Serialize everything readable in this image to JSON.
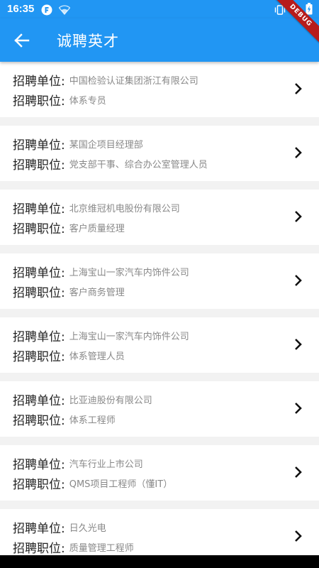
{
  "status_bar": {
    "time": "16:35",
    "icons": [
      "app-notification-icon",
      "wifi-icon",
      "vibrate-icon",
      "battery-icon"
    ]
  },
  "app_bar": {
    "title": "诚聘英才",
    "back_icon": "arrow-back-icon",
    "background": "#2196f3"
  },
  "debug_banner": "DEBUG",
  "jobs": [
    {
      "company_label": "招聘单位:",
      "company": "中国检验认证集团浙江有限公司",
      "position_label": "招聘职位:",
      "position": "体系专员"
    },
    {
      "company_label": "招聘单位:",
      "company": "某国企项目经理部",
      "position_label": "招聘职位:",
      "position": "党支部干事、综合办公室管理人员"
    },
    {
      "company_label": "招聘单位:",
      "company": "北京维冠机电股份有限公司",
      "position_label": "招聘职位:",
      "position": "客户质量经理"
    },
    {
      "company_label": "招聘单位:",
      "company": "上海宝山一家汽车内饰件公司",
      "position_label": "招聘职位:",
      "position": "客户商务管理"
    },
    {
      "company_label": "招聘单位:",
      "company": "上海宝山一家汽车内饰件公司",
      "position_label": "招聘职位:",
      "position": "体系管理人员"
    },
    {
      "company_label": "招聘单位:",
      "company": "比亚迪股份有限公司",
      "position_label": "招聘职位:",
      "position": "体系工程师"
    },
    {
      "company_label": "招聘单位:",
      "company": "汽车行业上市公司",
      "position_label": "招聘职位:",
      "position": "QMS项目工程师（懂IT）"
    },
    {
      "company_label": "招聘单位:",
      "company": "日久光电",
      "position_label": "招聘职位:",
      "position": "质量管理工程师"
    }
  ]
}
